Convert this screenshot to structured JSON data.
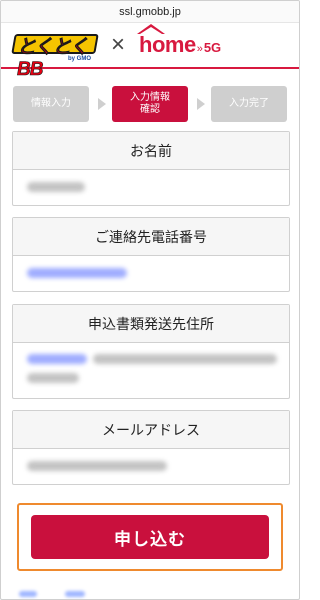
{
  "browser": {
    "url": "ssl.gmobb.jp"
  },
  "header": {
    "logo_left_text": "とくとくBB",
    "logo_left_sub": "by GMO",
    "times_symbol": "×",
    "logo_right_word": "home",
    "logo_right_arrows": "»",
    "logo_right_suffix": "5G"
  },
  "steps": [
    {
      "label": "情報入力",
      "state": "done"
    },
    {
      "label_line1": "入力情報",
      "label_line2": "確認",
      "state": "active"
    },
    {
      "label": "入力完了",
      "state": "todo"
    }
  ],
  "sections": [
    {
      "title": "お名前",
      "value": ""
    },
    {
      "title": "ご連絡先電話番号",
      "value": ""
    },
    {
      "title": "申込書類発送先住所",
      "value": ""
    },
    {
      "title": "メールアドレス",
      "value": ""
    }
  ],
  "submit": {
    "label": "申し込む"
  },
  "colors": {
    "brand_red": "#c9103d",
    "outline_orange": "#ef8a2e",
    "step_inactive": "#cfcfcf"
  }
}
